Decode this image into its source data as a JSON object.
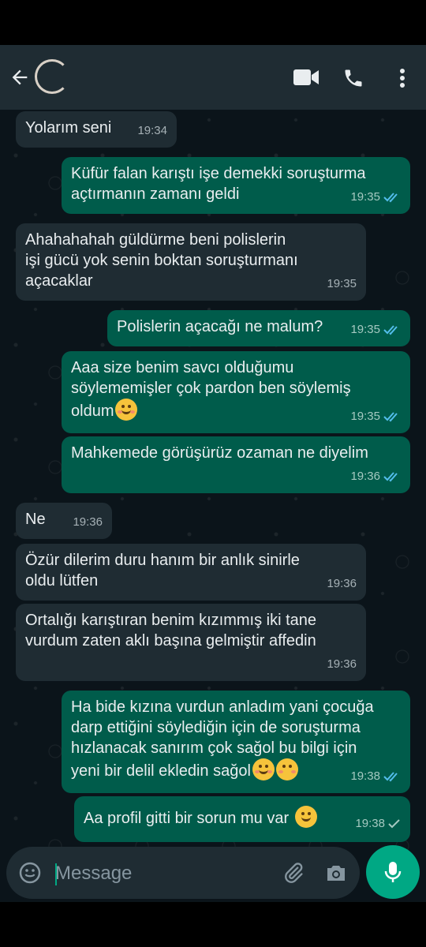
{
  "header": {
    "back_icon": "arrow-left-icon",
    "avatar_icon": "avatar",
    "video_icon": "video-camera-icon",
    "call_icon": "phone-icon",
    "menu_icon": "more-vertical-icon"
  },
  "messages": [
    {
      "dir": "in",
      "text": "Yolarım seni",
      "time": "19:34"
    },
    {
      "dir": "out",
      "text": "Küfür falan karıştı işe demekki soruşturma\naçtırmanın zamanı geldi",
      "time": "19:35",
      "ticks": "read"
    },
    {
      "dir": "in",
      "text": "Ahahahahah güldürme beni polislerin\nişi gücü yok senin boktan soruşturmanı\naçacaklar",
      "time": "19:35"
    },
    {
      "dir": "out",
      "text": "Polislerin açacağı ne malum?",
      "time": "19:35",
      "ticks": "read"
    },
    {
      "dir": "out",
      "text": "Aaa size benim savcı olduğumu\nsöylememişler çok pardon ben söylemiş\noldum",
      "time": "19:35",
      "ticks": "read",
      "emoji": "smiling-face-emoji"
    },
    {
      "dir": "out",
      "text": "Mahkemede görüşürüz ozaman ne diyelim",
      "time": "19:36",
      "ticks": "read"
    },
    {
      "dir": "in",
      "text": "Ne",
      "time": "19:36"
    },
    {
      "dir": "in",
      "text": "Özür dilerim duru hanım bir anlık sinirle\noldu lütfen",
      "time": "19:36"
    },
    {
      "dir": "in",
      "text": "Ortalığı karıştıran benim kızımmış iki tane\nvurdum zaten aklı başına gelmiştir affedin",
      "time": "19:36"
    },
    {
      "dir": "out",
      "text": "Ha bide kızına vurdun anladım yani çocuğa\ndarp ettiğini söylediğin için de soruşturma\nhızlanacak sanırım çok sağol bu bilgi için\nyeni bir delil ekledin sağol",
      "time": "19:38",
      "ticks": "read",
      "emoji": "relieved-face-emoji, kissing-face-emoji"
    },
    {
      "dir": "out",
      "text": "Aa profil gitti bir sorun mu var",
      "time": "19:38",
      "ticks": "sent",
      "emoji": "grinning-face-emoji"
    }
  ],
  "composer": {
    "placeholder": "Message",
    "emoji_icon": "emoji-icon",
    "attach_icon": "paperclip-icon",
    "camera_icon": "camera-icon",
    "mic_icon": "microphone-icon"
  },
  "colors": {
    "background": "#0b141a",
    "header": "#1f2c33",
    "incoming_bubble": "#1f2c33",
    "outgoing_bubble": "#005c4b",
    "read_tick": "#53bdeb",
    "accent": "#00a884"
  }
}
